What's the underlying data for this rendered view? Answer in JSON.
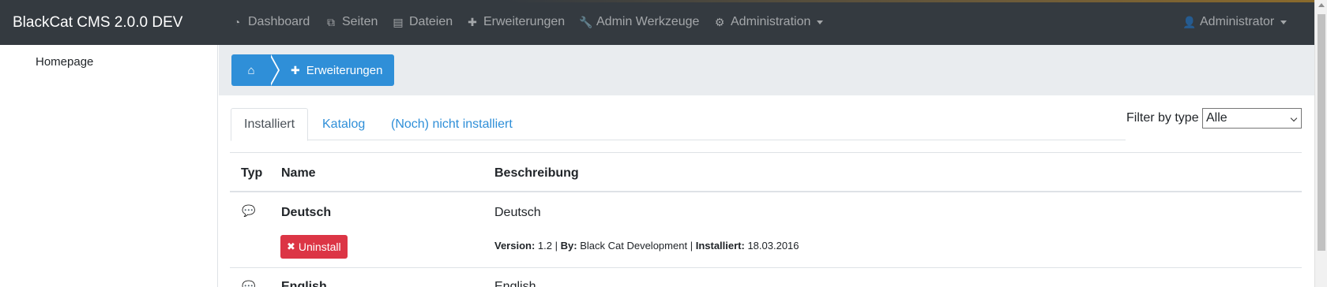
{
  "navbar": {
    "brand": "BlackCat CMS 2.0.0 DEV",
    "items": [
      {
        "label": "Dashboard",
        "icon": "dashboard-icon",
        "glyph": "◔"
      },
      {
        "label": "Seiten",
        "icon": "pages-icon",
        "glyph": "⧉"
      },
      {
        "label": "Dateien",
        "icon": "files-icon",
        "glyph": "▤"
      },
      {
        "label": "Erweiterungen",
        "icon": "puzzle-icon",
        "glyph": "✚"
      },
      {
        "label": "Admin Werkzeuge",
        "icon": "wrench-icon",
        "glyph": "🔧"
      },
      {
        "label": "Administration",
        "icon": "gears-icon",
        "glyph": "⚙"
      }
    ],
    "user": {
      "label": "Administrator",
      "icon": "user-icon",
      "glyph": "👤"
    }
  },
  "sidebar": {
    "items": [
      {
        "label": "Homepage"
      }
    ]
  },
  "breadcrumb": {
    "home_icon": "home-icon",
    "home_glyph": "⌂",
    "current": {
      "label": "Erweiterungen",
      "icon": "puzzle-icon",
      "glyph": "✚"
    },
    "color": "#2f8fd8"
  },
  "tabs": [
    {
      "label": "Installiert",
      "active": true
    },
    {
      "label": "Katalog",
      "active": false
    },
    {
      "label": "(Noch) nicht installiert",
      "active": false
    }
  ],
  "filter": {
    "label": "Filter by type",
    "selected": "Alle"
  },
  "table": {
    "headers": {
      "type": "Typ",
      "name": "Name",
      "description": "Beschreibung"
    },
    "rows": [
      {
        "type_icon": "comments-icon",
        "type_glyph": "💬",
        "name": "Deutsch",
        "description": "Deutsch",
        "button": {
          "label": "Uninstall",
          "icon": "times-icon",
          "glyph": "✖"
        },
        "meta": {
          "version_label": "Version:",
          "version": "1.2",
          "by_label": "By:",
          "by": "Black Cat Development",
          "installed_label": "Installiert:",
          "installed": "18.03.2016",
          "sep": "|"
        }
      },
      {
        "type_icon": "comments-icon",
        "type_glyph": "💬",
        "name": "English",
        "description": "English"
      }
    ]
  },
  "colors": {
    "navbar": "#343a40",
    "link": "#2f8fd8",
    "danger": "#dc3545",
    "crumb_bg": "#e9ecef"
  }
}
